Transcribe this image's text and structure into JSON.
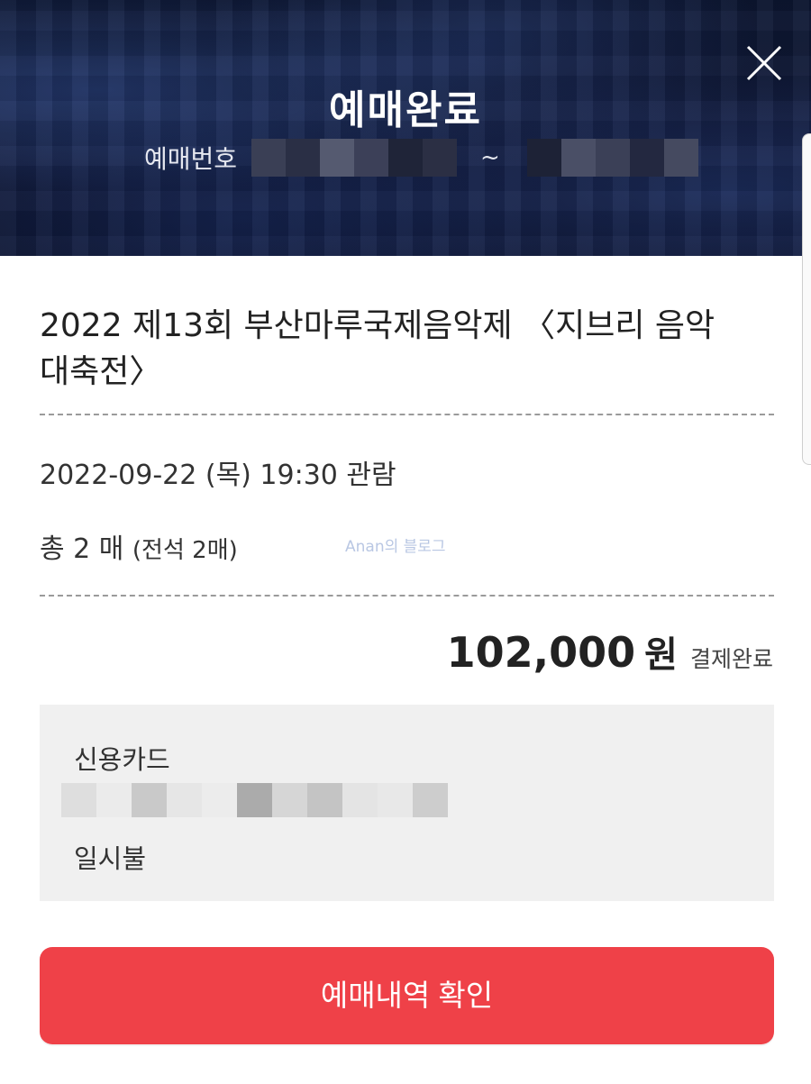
{
  "header": {
    "title": "예매완료",
    "booking_number_label": "예매번호",
    "booking_number_separator": "~"
  },
  "event": {
    "title": "2022 제13회 부산마루국제음악제 〈지브리 음악 대축전〉",
    "datetime": "2022-09-22 (목) 19:30 관람",
    "ticket_count": "총 2 매",
    "seat_detail": "(전석 2매)"
  },
  "watermark": "Anan의 블로그",
  "payment": {
    "amount": "102,000",
    "currency": "원",
    "status": "결제완료",
    "method": "신용카드",
    "installment": "일시불"
  },
  "actions": {
    "confirm_label": "예매내역 확인"
  },
  "icons": {
    "close": "close-icon"
  },
  "colors": {
    "accent": "#ef4148",
    "header_bg": "#111a3a"
  }
}
